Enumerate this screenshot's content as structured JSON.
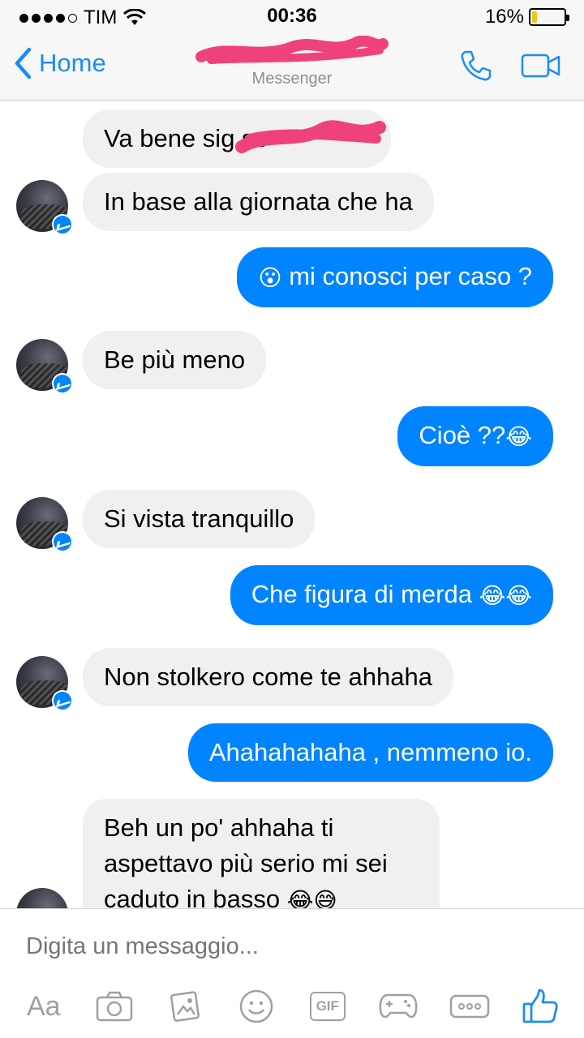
{
  "status_bar": {
    "carrier": "TIM",
    "time": "00:36",
    "battery_percent": "16%",
    "battery_level": 0.16,
    "signal_bars": 4
  },
  "nav": {
    "back_label": "Home",
    "subtitle": "Messenger",
    "icons": [
      "phone-icon",
      "video-camera-icon"
    ]
  },
  "messages": [
    {
      "from": "them",
      "text": "Va bene sig so"
    },
    {
      "from": "them",
      "text": "In base alla giornata che ha"
    },
    {
      "from": "me",
      "emoji_before": "😮",
      "text": " mi conosci per caso ?"
    },
    {
      "from": "them",
      "text": "Be più meno"
    },
    {
      "from": "me",
      "text": "Cioè ??",
      "emoji_after": "😂"
    },
    {
      "from": "them",
      "text": "Si vista tranquillo"
    },
    {
      "from": "me",
      "text": "Che figura di merda ",
      "emoji_after": "😂😂"
    },
    {
      "from": "them",
      "text": "Non stolkero come te ahhaha"
    },
    {
      "from": "me",
      "text": "Ahahahahaha , nemmeno io."
    },
    {
      "from": "them",
      "lines": [
        "Beh un po' ahhaha ti",
        "aspettavo più serio mi sei",
        "caduto in basso"
      ],
      "emoji_after": "😂😅"
    }
  ],
  "composer": {
    "placeholder": "Digita un messaggio...",
    "aa_label": "Aa",
    "gif_label": "GIF",
    "toolbar_icons": [
      "text-format-icon",
      "camera-icon",
      "gallery-icon",
      "smiley-icon",
      "gif-icon",
      "game-controller-icon",
      "more-icon",
      "thumbs-up-icon"
    ]
  },
  "colors": {
    "accent": "#0084ff",
    "nav_blue": "#1b8cf6",
    "incoming_bubble": "#f1f0f0",
    "redaction": "#f0427a",
    "battery": "#f0c419"
  }
}
